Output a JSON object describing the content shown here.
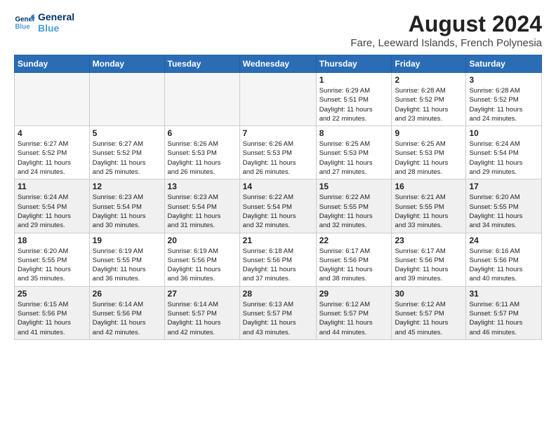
{
  "header": {
    "logo_line1": "General",
    "logo_line2": "Blue",
    "month_year": "August 2024",
    "location": "Fare, Leeward Islands, French Polynesia"
  },
  "days_of_week": [
    "Sunday",
    "Monday",
    "Tuesday",
    "Wednesday",
    "Thursday",
    "Friday",
    "Saturday"
  ],
  "weeks": [
    [
      {
        "day": "",
        "info": ""
      },
      {
        "day": "",
        "info": ""
      },
      {
        "day": "",
        "info": ""
      },
      {
        "day": "",
        "info": ""
      },
      {
        "day": "1",
        "info": "Sunrise: 6:29 AM\nSunset: 5:51 PM\nDaylight: 11 hours\nand 22 minutes."
      },
      {
        "day": "2",
        "info": "Sunrise: 6:28 AM\nSunset: 5:52 PM\nDaylight: 11 hours\nand 23 minutes."
      },
      {
        "day": "3",
        "info": "Sunrise: 6:28 AM\nSunset: 5:52 PM\nDaylight: 11 hours\nand 24 minutes."
      }
    ],
    [
      {
        "day": "4",
        "info": "Sunrise: 6:27 AM\nSunset: 5:52 PM\nDaylight: 11 hours\nand 24 minutes."
      },
      {
        "day": "5",
        "info": "Sunrise: 6:27 AM\nSunset: 5:52 PM\nDaylight: 11 hours\nand 25 minutes."
      },
      {
        "day": "6",
        "info": "Sunrise: 6:26 AM\nSunset: 5:53 PM\nDaylight: 11 hours\nand 26 minutes."
      },
      {
        "day": "7",
        "info": "Sunrise: 6:26 AM\nSunset: 5:53 PM\nDaylight: 11 hours\nand 26 minutes."
      },
      {
        "day": "8",
        "info": "Sunrise: 6:25 AM\nSunset: 5:53 PM\nDaylight: 11 hours\nand 27 minutes."
      },
      {
        "day": "9",
        "info": "Sunrise: 6:25 AM\nSunset: 5:53 PM\nDaylight: 11 hours\nand 28 minutes."
      },
      {
        "day": "10",
        "info": "Sunrise: 6:24 AM\nSunset: 5:54 PM\nDaylight: 11 hours\nand 29 minutes."
      }
    ],
    [
      {
        "day": "11",
        "info": "Sunrise: 6:24 AM\nSunset: 5:54 PM\nDaylight: 11 hours\nand 29 minutes."
      },
      {
        "day": "12",
        "info": "Sunrise: 6:23 AM\nSunset: 5:54 PM\nDaylight: 11 hours\nand 30 minutes."
      },
      {
        "day": "13",
        "info": "Sunrise: 6:23 AM\nSunset: 5:54 PM\nDaylight: 11 hours\nand 31 minutes."
      },
      {
        "day": "14",
        "info": "Sunrise: 6:22 AM\nSunset: 5:54 PM\nDaylight: 11 hours\nand 32 minutes."
      },
      {
        "day": "15",
        "info": "Sunrise: 6:22 AM\nSunset: 5:55 PM\nDaylight: 11 hours\nand 32 minutes."
      },
      {
        "day": "16",
        "info": "Sunrise: 6:21 AM\nSunset: 5:55 PM\nDaylight: 11 hours\nand 33 minutes."
      },
      {
        "day": "17",
        "info": "Sunrise: 6:20 AM\nSunset: 5:55 PM\nDaylight: 11 hours\nand 34 minutes."
      }
    ],
    [
      {
        "day": "18",
        "info": "Sunrise: 6:20 AM\nSunset: 5:55 PM\nDaylight: 11 hours\nand 35 minutes."
      },
      {
        "day": "19",
        "info": "Sunrise: 6:19 AM\nSunset: 5:55 PM\nDaylight: 11 hours\nand 36 minutes."
      },
      {
        "day": "20",
        "info": "Sunrise: 6:19 AM\nSunset: 5:56 PM\nDaylight: 11 hours\nand 36 minutes."
      },
      {
        "day": "21",
        "info": "Sunrise: 6:18 AM\nSunset: 5:56 PM\nDaylight: 11 hours\nand 37 minutes."
      },
      {
        "day": "22",
        "info": "Sunrise: 6:17 AM\nSunset: 5:56 PM\nDaylight: 11 hours\nand 38 minutes."
      },
      {
        "day": "23",
        "info": "Sunrise: 6:17 AM\nSunset: 5:56 PM\nDaylight: 11 hours\nand 39 minutes."
      },
      {
        "day": "24",
        "info": "Sunrise: 6:16 AM\nSunset: 5:56 PM\nDaylight: 11 hours\nand 40 minutes."
      }
    ],
    [
      {
        "day": "25",
        "info": "Sunrise: 6:15 AM\nSunset: 5:56 PM\nDaylight: 11 hours\nand 41 minutes."
      },
      {
        "day": "26",
        "info": "Sunrise: 6:14 AM\nSunset: 5:56 PM\nDaylight: 11 hours\nand 42 minutes."
      },
      {
        "day": "27",
        "info": "Sunrise: 6:14 AM\nSunset: 5:57 PM\nDaylight: 11 hours\nand 42 minutes."
      },
      {
        "day": "28",
        "info": "Sunrise: 6:13 AM\nSunset: 5:57 PM\nDaylight: 11 hours\nand 43 minutes."
      },
      {
        "day": "29",
        "info": "Sunrise: 6:12 AM\nSunset: 5:57 PM\nDaylight: 11 hours\nand 44 minutes."
      },
      {
        "day": "30",
        "info": "Sunrise: 6:12 AM\nSunset: 5:57 PM\nDaylight: 11 hours\nand 45 minutes."
      },
      {
        "day": "31",
        "info": "Sunrise: 6:11 AM\nSunset: 5:57 PM\nDaylight: 11 hours\nand 46 minutes."
      }
    ]
  ]
}
